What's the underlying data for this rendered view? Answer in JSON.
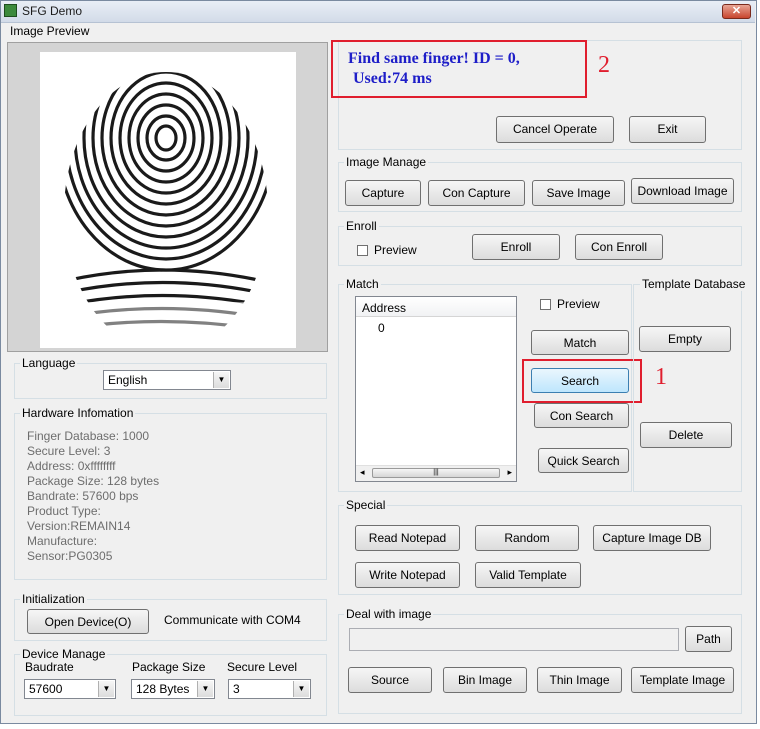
{
  "window": {
    "title": "SFG Demo",
    "close_glyph": "✕"
  },
  "preview": {
    "label": "Image Preview"
  },
  "message": {
    "line1": "Find same finger! ID = 0,",
    "line2": "Used:74 ms",
    "annotation": "2"
  },
  "operate": {
    "cancel": "Cancel Operate",
    "exit": "Exit"
  },
  "image_manage": {
    "label": "Image Manage",
    "capture": "Capture",
    "con_capture": "Con Capture",
    "save_image": "Save Image",
    "download_image": "Download Image"
  },
  "enroll": {
    "label": "Enroll",
    "preview": "Preview",
    "enroll": "Enroll",
    "con_enroll": "Con Enroll"
  },
  "match": {
    "label": "Match",
    "list_header": "Address",
    "rows": [
      "0"
    ],
    "preview": "Preview",
    "match": "Match",
    "search": "Search",
    "con_search": "Con Search",
    "quick_search": "Quick Search",
    "annotation": "1",
    "scroll_left": "◂",
    "scroll_right": "▸",
    "scroll_grip": "|||"
  },
  "template_db": {
    "label": "Template Database",
    "empty": "Empty",
    "delete": "Delete"
  },
  "language": {
    "label": "Language",
    "value": "English"
  },
  "hardware": {
    "label": "Hardware Infomation",
    "lines": [
      "Finger Database: 1000",
      "Secure Level: 3",
      "Address: 0xffffffff",
      "Package Size: 128 bytes",
      "Bandrate: 57600 bps",
      "Product Type:",
      "Version:REMAIN14",
      "Manufacture:",
      "Sensor:PG0305"
    ]
  },
  "init": {
    "label": "Initialization",
    "open_device": "Open Device(O)",
    "status": "Communicate with COM4"
  },
  "device": {
    "label": "Device Manage",
    "baudrate_label": "Baudrate",
    "baudrate": "57600",
    "package_label": "Package Size",
    "package": "128 Bytes",
    "secure_label": "Secure Level",
    "secure": "3"
  },
  "special": {
    "label": "Special",
    "read_notepad": "Read Notepad",
    "random": "Random",
    "capture_db": "Capture Image DB",
    "write_notepad": "Write Notepad",
    "valid_template": "Valid Template"
  },
  "deal": {
    "label": "Deal with image",
    "path_value": "",
    "path": "Path",
    "source": "Source",
    "bin_image": "Bin Image",
    "thin_image": "Thin Image",
    "template_image": "Template Image"
  },
  "colors": {
    "annotation_red": "#e01e2e",
    "message_blue": "#1e1ec8"
  }
}
